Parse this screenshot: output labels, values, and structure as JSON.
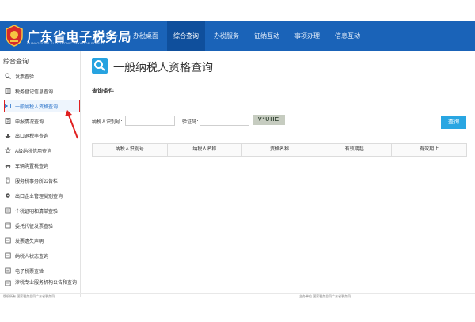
{
  "header": {
    "title": "广东省电子税务局",
    "subtitle": "GUANGDONG ELECTRONIC TAXATION BUREAU",
    "nav": [
      {
        "label": "办税桌面"
      },
      {
        "label": "综合查询"
      },
      {
        "label": "办税服务"
      },
      {
        "label": "征纳互动"
      },
      {
        "label": "事项办理"
      },
      {
        "label": "信息互动"
      }
    ],
    "active_nav": "综合查询"
  },
  "sidebar": {
    "title": "综合查询",
    "items": [
      {
        "label": "发票查验",
        "icon": "search-icon"
      },
      {
        "label": "税务登记信息查询",
        "icon": "document-icon"
      },
      {
        "label": "一般纳税人资格查询",
        "icon": "id-card-icon"
      },
      {
        "label": "申报情况查询",
        "icon": "report-icon"
      },
      {
        "label": "出口退税率查询",
        "icon": "ship-icon"
      },
      {
        "label": "A级纳税信用查询",
        "icon": "star-icon"
      },
      {
        "label": "车辆购置税查询",
        "icon": "car-icon"
      },
      {
        "label": "服务税事务所公告栏",
        "icon": "notice-icon"
      },
      {
        "label": "出口企业管理类别查询",
        "icon": "gear-icon"
      },
      {
        "label": "个税证明和清单查验",
        "icon": "certificate-icon"
      },
      {
        "label": "委托代征发票查验",
        "icon": "invoice-icon"
      },
      {
        "label": "发票遗失声明",
        "icon": "declare-icon"
      },
      {
        "label": "纳税人状态查询",
        "icon": "status-icon"
      },
      {
        "label": "电子税票查验",
        "icon": "ticket-icon"
      },
      {
        "label": "涉税专业服务机构公告和查询",
        "icon": "org-icon"
      }
    ]
  },
  "main": {
    "title": "一般纳税人资格查询",
    "section_title": "查询条件",
    "taxpayer_id_label": "纳税人识别号：",
    "taxpayer_id_value": "",
    "captcha_label": "验证码：",
    "captcha_value": "",
    "captcha_text": "V*UHE",
    "query_button": "查询",
    "table_headers": [
      "纳税人识别号",
      "纳税人名称",
      "资格名称",
      "有效期起",
      "有效期止"
    ]
  },
  "footer": {
    "left": "版权所有 国家税务总局广东省税务局",
    "right": "主办单位 国家税务总局广东省税务局"
  },
  "colors": {
    "header_bg": "#1a63b8",
    "active_nav_bg": "#0f4f9c",
    "accent": "#29a6e2",
    "highlight_border": "#e02020"
  }
}
